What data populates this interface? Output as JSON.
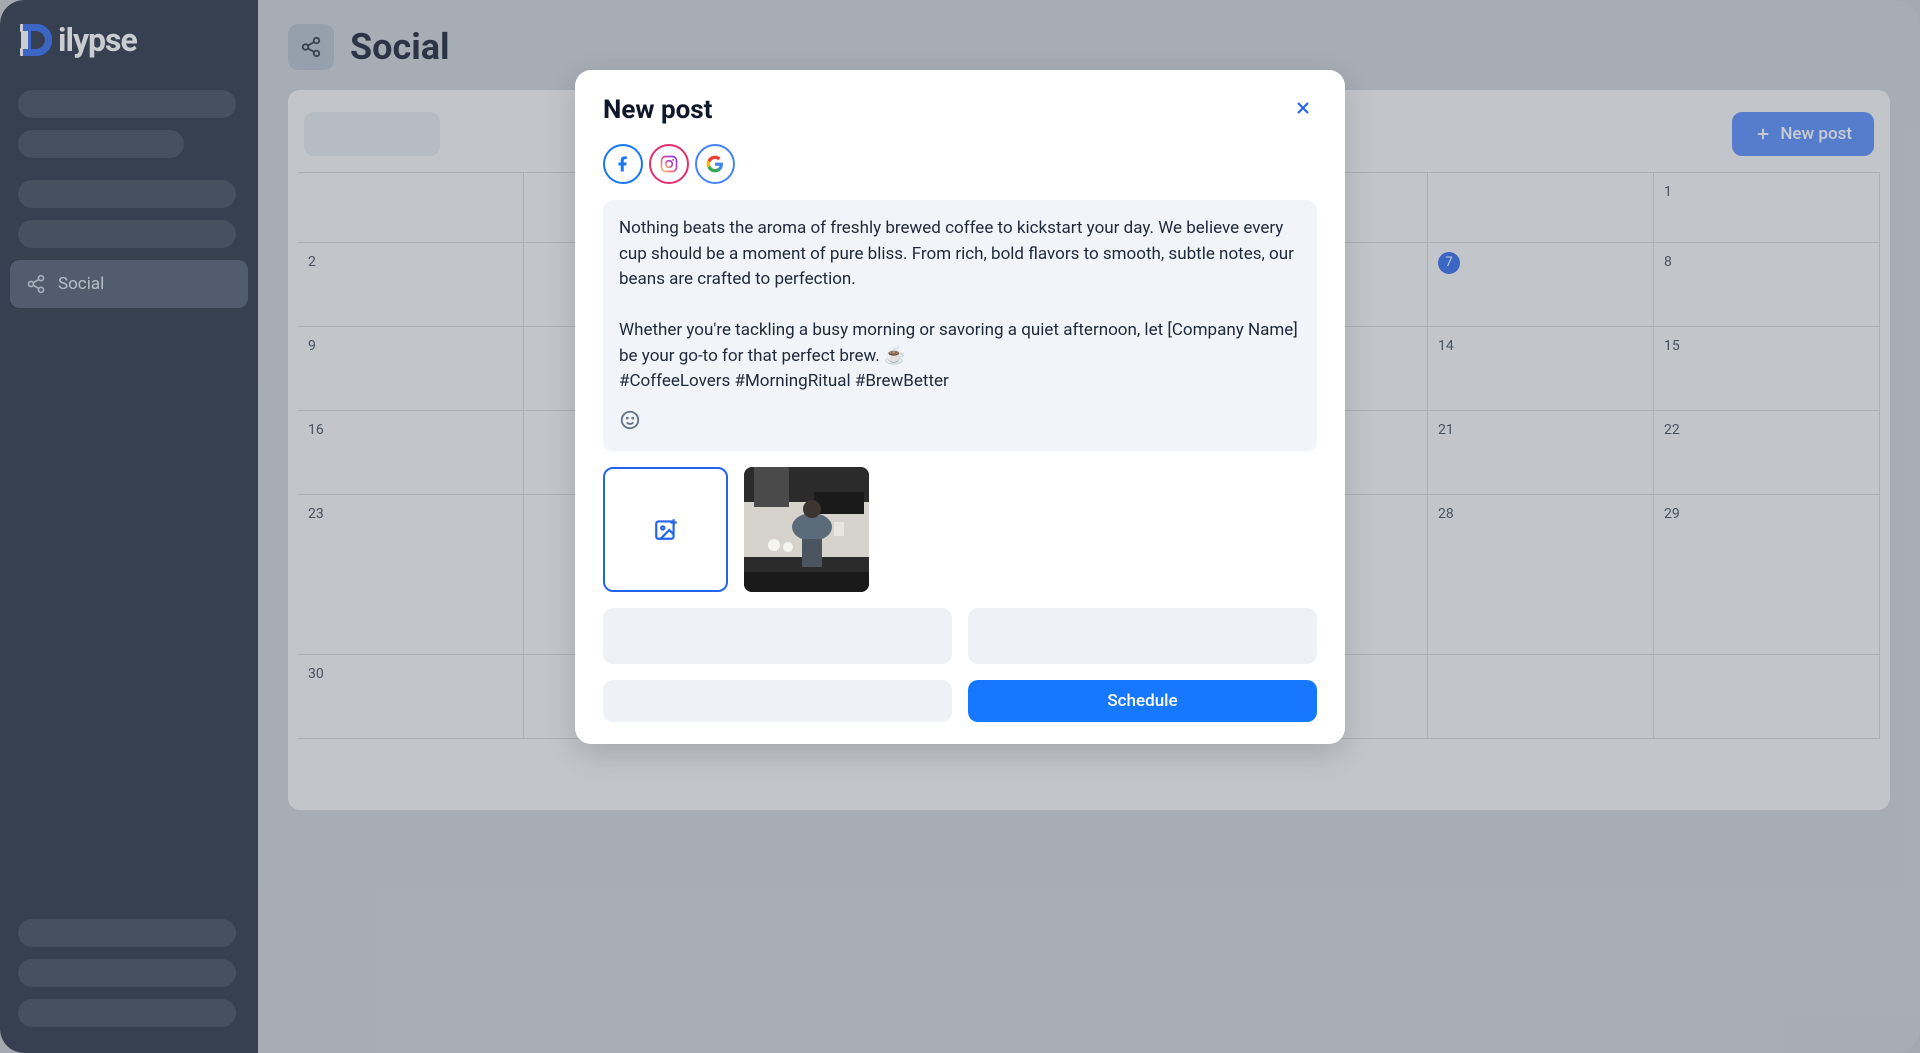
{
  "logo": {
    "text": "ilypse"
  },
  "sidebar": {
    "social_label": "Social"
  },
  "page": {
    "title": "Social"
  },
  "toolbar": {
    "new_post_label": "New post"
  },
  "calendar": {
    "rows": [
      [
        "",
        "",
        "",
        "",
        "",
        "",
        "1"
      ],
      [
        "2",
        "",
        "",
        "",
        "",
        "7",
        "8"
      ],
      [
        "9",
        "",
        "",
        "",
        "",
        "14",
        "15"
      ],
      [
        "16",
        "",
        "",
        "",
        "",
        "21",
        "22"
      ],
      [
        "23",
        "",
        "",
        "",
        "",
        "28",
        "29"
      ],
      [
        "30",
        "",
        "",
        "",
        "",
        "",
        ""
      ]
    ],
    "highlighted_date": "7",
    "event_text": "Nothing beats the a..."
  },
  "modal": {
    "title": "New post",
    "composer_text": "Nothing beats the aroma of freshly brewed coffee to kickstart your day. We believe every cup should be a moment of pure bliss. From rich, bold flavors to smooth, subtle notes, our beans are crafted to perfection.\n\nWhether you're tackling a busy morning or savoring a quiet afternoon, let [Company Name] be your go-to for that perfect brew. ☕\n#CoffeeLovers #MorningRitual #BrewBetter",
    "schedule_label": "Schedule",
    "platforms": [
      "facebook",
      "instagram",
      "google"
    ]
  }
}
